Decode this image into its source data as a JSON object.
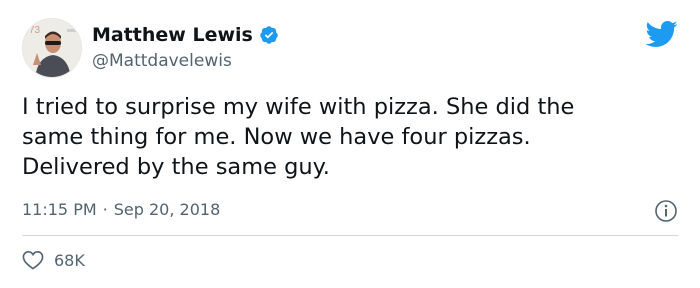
{
  "author": {
    "display_name": "Matthew Lewis",
    "handle": "@Mattdavelewis",
    "verified": true
  },
  "tweet": {
    "text": "I tried to surprise my wife with pizza. She did the\nsame thing for me. Now we have four pizzas.\nDelivered by the same guy.",
    "time": "11:15 PM",
    "separator": "·",
    "date": "Sep 20, 2018"
  },
  "stats": {
    "likes": "68K"
  },
  "icons": {
    "brand": "twitter-bird-icon",
    "verified": "verified-badge-icon",
    "info": "info-icon",
    "like": "heart-icon"
  },
  "colors": {
    "brand_blue": "#1d9bf0",
    "text": "#0f1419",
    "secondary": "#536471",
    "divider": "#cfd9de"
  }
}
